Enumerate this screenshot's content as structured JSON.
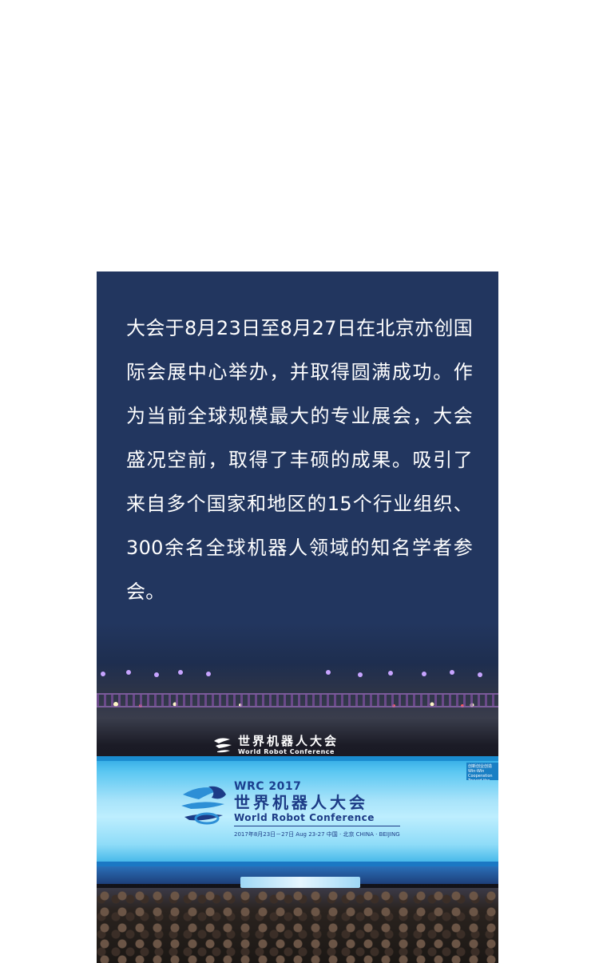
{
  "article": {
    "paragraph": "大会于8月23日至8月27日在北京亦创国际会展中心举办，并取得圆满成功。作为当前全球规模最大的专业展会，大会盛况空前，取得了丰硕的成果。吸引了来自多个国家和地区的15个行业组织、300余名全球机器人领域的知名学者参会。"
  },
  "photo": {
    "top_logo": {
      "cn": "世界机器人大会",
      "en": "World Robot Conference"
    },
    "screen": {
      "wrc": "WRC 2017",
      "cn": "世界机器人大会",
      "en": "World Robot Conference",
      "dates": "2017年8月23日－27日 Aug 23-27    中国 · 北京 CHINA · BEIJING",
      "side_panel": "创新创业创造 Win-Win Cooperation Toward the Building"
    },
    "stage_label": "世界机器人大会"
  },
  "colors": {
    "card_bg": "#22365f",
    "text": "#ffffff",
    "brand_blue": "#1c3b86"
  }
}
